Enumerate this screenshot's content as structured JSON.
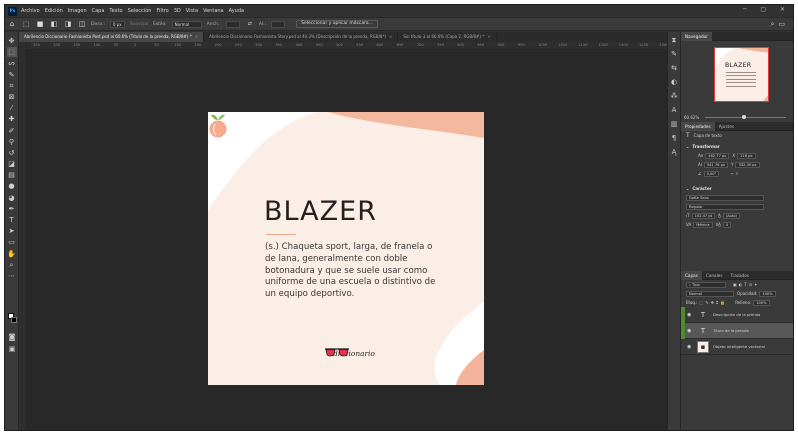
{
  "menu": {
    "app_logo": "Ps",
    "items": [
      "Archivo",
      "Edición",
      "Imagen",
      "Capa",
      "Texto",
      "Selección",
      "Filtro",
      "3D",
      "Vista",
      "Ventana",
      "Ayuda"
    ]
  },
  "options": {
    "feather_label": "Desv.:",
    "feather_value": "0 px",
    "antialias_label": "Suavizar",
    "style_label": "Estilo:",
    "style_value": "Normal",
    "width_label": "Anch.:",
    "height_label": "Al.:",
    "select_mask_button": "Seleccionar y aplicar máscara..."
  },
  "tabs": [
    {
      "label": "Abrilencio Diccionario Fashionista Post.psd al 60.6% (Título de la prenda, RGB/8#) *",
      "active": true
    },
    {
      "label": "Abrilencio Diccionario Fashionista Story.psd al 40.3% (Descripción de la prenda, RGB/8*)",
      "active": false
    },
    {
      "label": "Sin título-3 al 66.6% (Capa 2, RGB/8#) *",
      "active": false
    }
  ],
  "ruler_ticks": [
    "250",
    "200",
    "150",
    "100",
    "50",
    "0",
    "50",
    "100",
    "150",
    "200",
    "250",
    "300",
    "350",
    "400",
    "450",
    "500",
    "550",
    "600",
    "650",
    "700",
    "750",
    "800",
    "850",
    "900",
    "950",
    "1000",
    "1050",
    "1100",
    "1150",
    "1200",
    "1250",
    "1300"
  ],
  "document": {
    "title": "BLAZER",
    "body": "(s.) Chaqueta sport, larga, de franela o de lana, generalmente con doble botonadura y que se suele usar como uniforme de una escuela o distintivo de un equipo deportivo.",
    "logo_text": "diccionario"
  },
  "navigator": {
    "tabs": [
      "Navegador"
    ],
    "thumb_title": "BLAZER",
    "zoom_value": "60.62%"
  },
  "properties": {
    "tabs": [
      "Propiedades",
      "Ajustes"
    ],
    "layer_type": "Capa de texto",
    "transform_label": "Transformar",
    "w_label": "An",
    "w_value": "462.77 px",
    "x_label": "X",
    "x_value": "216 px",
    "h_label": "Al",
    "h_value": "541.76 px",
    "y_value": "332.35 px",
    "angle_value": "0,00°",
    "character_label": "Carácter",
    "font_family": "Gotte Sans",
    "font_style": "Regular",
    "font_size": "102.47 pt",
    "leading": "(Auto)",
    "kerning": "Métrica",
    "tracking": "0"
  },
  "layers": {
    "tabs": [
      "Capas",
      "Canales",
      "Trazados"
    ],
    "filter_label": "Tipo",
    "blend_mode": "Normal",
    "opacity_label": "Opacidad:",
    "opacity_value": "100%",
    "lock_label": "Bloq.:",
    "fill_label": "Relleno:",
    "fill_value": "100%",
    "items": [
      {
        "name": "Descripción de la prenda",
        "kind": "text",
        "selected": false,
        "linked": true
      },
      {
        "name": "Título de la prenda",
        "kind": "text",
        "selected": true,
        "linked": true
      },
      {
        "name": "Objeto inteligente vectorial",
        "kind": "smart",
        "selected": false,
        "linked": false
      }
    ]
  },
  "colors": {
    "doc_background": "#fbeee7",
    "accent_peach": "#f3b49b",
    "title_color": "#23201f",
    "app_background": "#323232",
    "canvas_background": "#282828"
  }
}
